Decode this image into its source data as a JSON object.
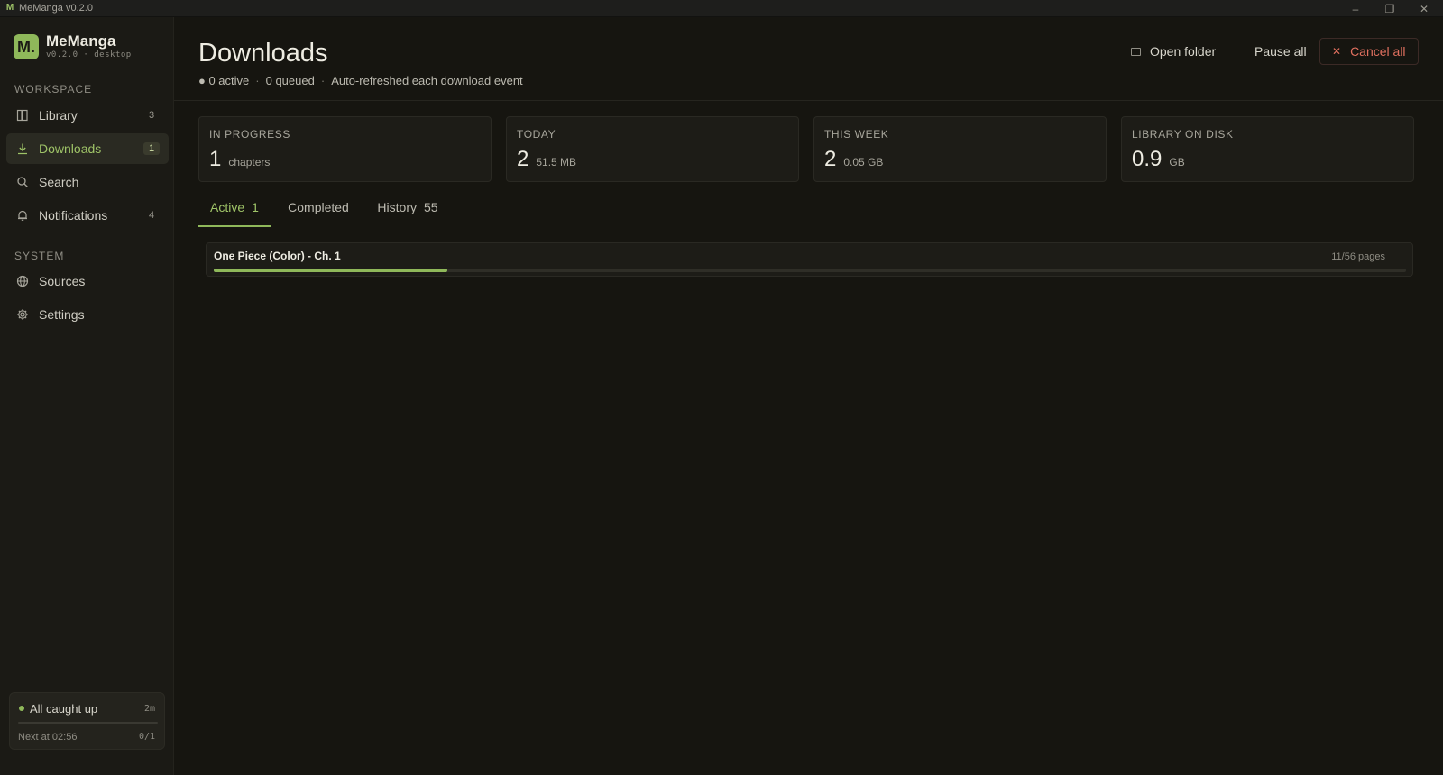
{
  "window": {
    "title": "MeManga v0.2.0",
    "app_glyph": "M",
    "controls": {
      "minimize": "–",
      "maximize": "❐",
      "close": "✕"
    }
  },
  "sidebar": {
    "brand": {
      "logo_text": "M.",
      "name": "MeManga",
      "version": "v0.2.0 · desktop"
    },
    "workspace_label": "WORKSPACE",
    "workspace_items": [
      {
        "label": "Library",
        "icon": "library-icon",
        "badge": "3"
      },
      {
        "label": "Downloads",
        "icon": "download-icon",
        "badge": "1",
        "active": true
      },
      {
        "label": "Search",
        "icon": "search-icon",
        "badge": ""
      },
      {
        "label": "Notifications",
        "icon": "bell-icon",
        "badge": "4"
      }
    ],
    "system_label": "SYSTEM",
    "system_items": [
      {
        "label": "Sources",
        "icon": "globe-icon"
      },
      {
        "label": "Settings",
        "icon": "gear-icon"
      }
    ],
    "status": {
      "label": "All caught up",
      "time": "2m",
      "next": "Next at 02:56",
      "count": "0/1"
    }
  },
  "header": {
    "title": "Downloads",
    "active_text": "● 0 active",
    "queued_text": "0 queued",
    "refresh_text": "Auto-refreshed each download event",
    "separator": "·",
    "actions": {
      "open_folder": "Open folder",
      "pause_all": "Pause all",
      "cancel_all": "Cancel all",
      "cancel_icon": "✕"
    }
  },
  "stats": [
    {
      "label": "IN PROGRESS",
      "value": "1",
      "unit": "chapters"
    },
    {
      "label": "TODAY",
      "value": "2",
      "unit": "51.5 MB"
    },
    {
      "label": "THIS WEEK",
      "value": "2",
      "unit": "0.05 GB"
    },
    {
      "label": "LIBRARY ON DISK",
      "value": "0.9",
      "unit": "GB"
    }
  ],
  "tabs": [
    {
      "label": "Active",
      "count": "1",
      "active": true
    },
    {
      "label": "Completed",
      "count": ""
    },
    {
      "label": "History",
      "count": "55"
    }
  ],
  "downloads": [
    {
      "title": "One Piece (Color) - Ch. 1",
      "pages": "11/56 pages",
      "progress": 0.196
    }
  ],
  "colors": {
    "accent": "#8fb85a",
    "danger": "#e0705f",
    "background": "#161510",
    "sidebar": "#1b1a15"
  }
}
